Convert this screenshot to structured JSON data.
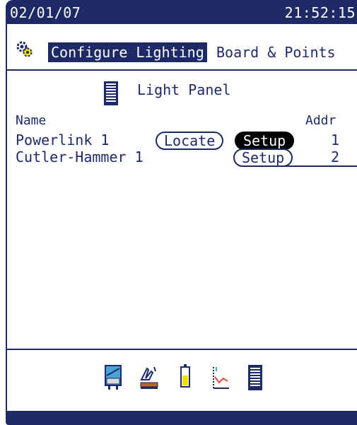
{
  "status_bar": {
    "date": "02/01/07",
    "time": "21:52:15"
  },
  "header": {
    "active_tab": "Configure Lighting",
    "other_tab": "Board & Points"
  },
  "panel": {
    "title": "Light Panel"
  },
  "table": {
    "col_name": "Name",
    "col_addr": "Addr",
    "rows": [
      {
        "name": "Powerlink 1",
        "locate_label": "Locate",
        "setup_label": "Setup",
        "addr": "1"
      },
      {
        "name": "Cutler-Hammer 1",
        "setup_label": "Setup",
        "addr": "2"
      }
    ]
  },
  "toolbar_icons": [
    "door-panel-icon",
    "hand-lever-icon",
    "battery-icon",
    "trend-graph-icon",
    "light-panel-icon"
  ],
  "colors": {
    "navy": "#1e2a66",
    "accent_blue": "#4aa3d6",
    "yellow": "#f2e100",
    "red": "#d94a3a"
  }
}
